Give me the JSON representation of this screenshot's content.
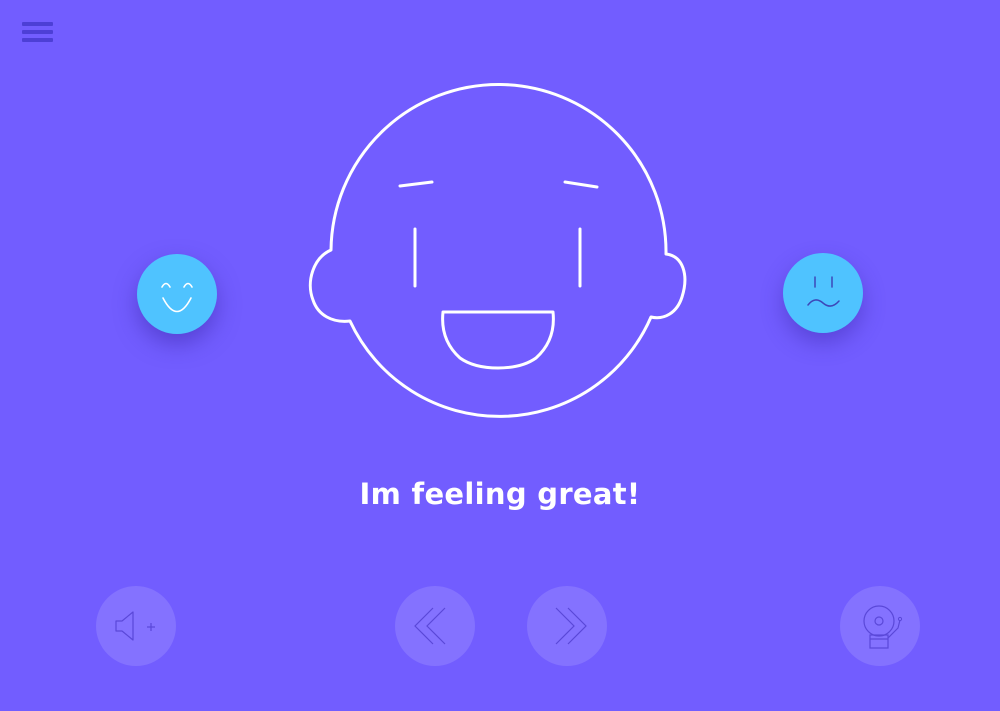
{
  "caption": {
    "text": "Im feeling great!"
  },
  "mood_options": [
    {
      "name": "happy",
      "icon": "happy-face-icon",
      "color": "#4fc3ff"
    },
    {
      "name": "meh",
      "icon": "wavy-mouth-face-icon",
      "color": "#4fc3ff"
    }
  ],
  "controls": [
    {
      "name": "volume",
      "icon": "speaker-plus-icon"
    },
    {
      "name": "previous",
      "icon": "double-chevron-left-icon"
    },
    {
      "name": "next",
      "icon": "double-chevron-right-icon"
    },
    {
      "name": "alarm",
      "icon": "alarm-bell-icon"
    }
  ],
  "colors": {
    "background": "#725dff",
    "accent": "#4fc3ff",
    "face_stroke": "#ffffff",
    "menu_icon": "#4d3fd6"
  }
}
